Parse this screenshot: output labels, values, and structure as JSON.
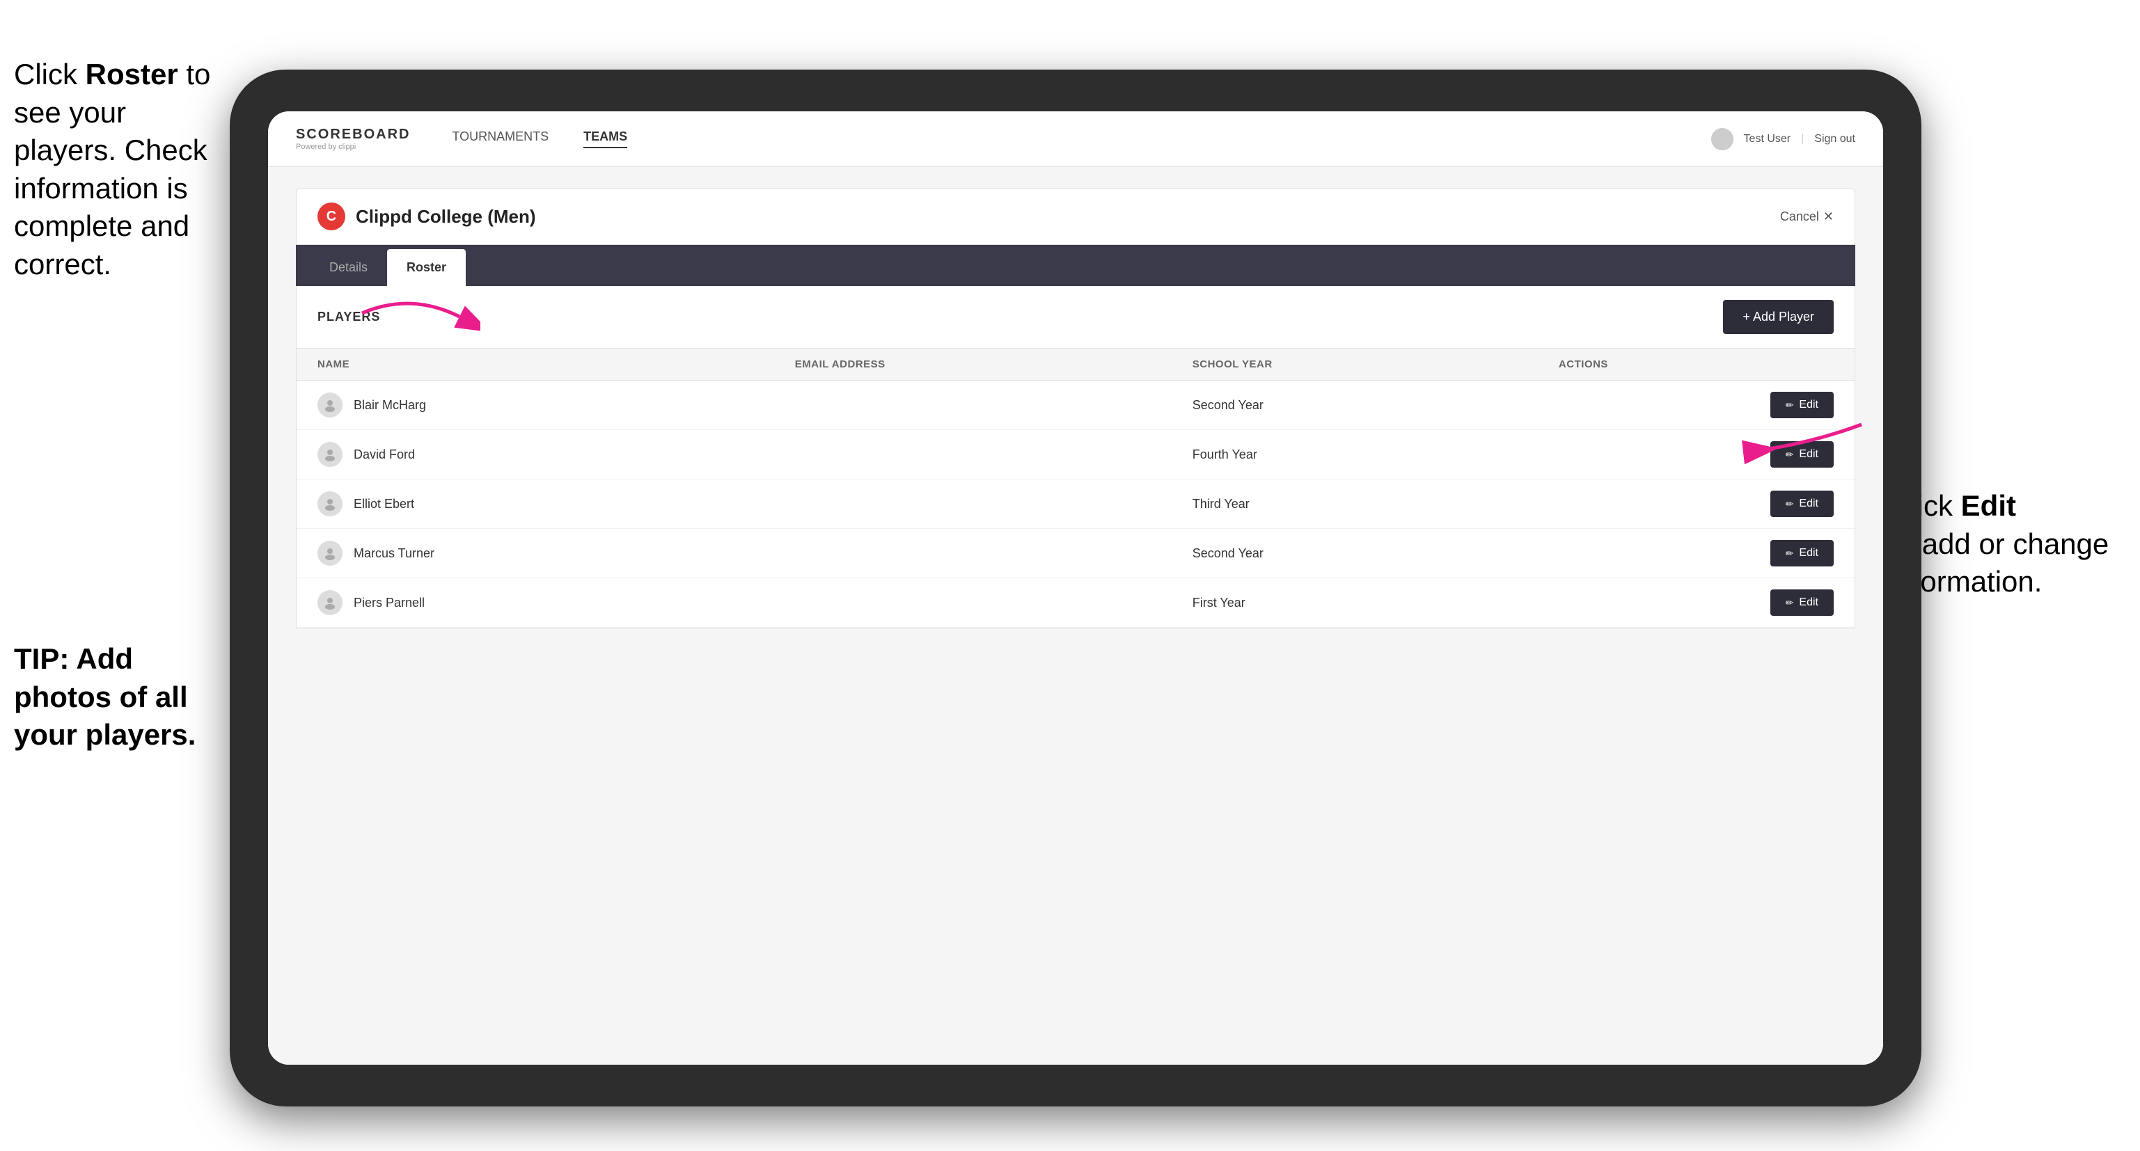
{
  "left_annotation": {
    "line1": "Click ",
    "bold1": "Roster",
    "line2": " to",
    "line3": "see your players.",
    "line4": "Check information",
    "line5": "is complete and",
    "line6": "correct."
  },
  "tip_annotation": {
    "text": "TIP: Add photos of all your players."
  },
  "right_annotation": {
    "line1": "Click ",
    "bold1": "Edit",
    "line2": "to add or change",
    "line3": "information."
  },
  "nav": {
    "logo": "SCOREBOARD",
    "logo_sub": "Powered by clippi",
    "links": [
      "TOURNAMENTS",
      "TEAMS"
    ],
    "active_link": "TEAMS",
    "user": "Test User",
    "separator": "|",
    "signout": "Sign out"
  },
  "team": {
    "logo_letter": "C",
    "name": "Clippd College (Men)",
    "cancel_label": "Cancel",
    "cancel_icon": "✕"
  },
  "tabs": [
    {
      "label": "Details",
      "active": false
    },
    {
      "label": "Roster",
      "active": true
    }
  ],
  "roster": {
    "section_label": "PLAYERS",
    "add_button_label": "+ Add Player",
    "columns": [
      "NAME",
      "EMAIL ADDRESS",
      "SCHOOL YEAR",
      "ACTIONS"
    ],
    "players": [
      {
        "name": "Blair McHarg",
        "email": "",
        "school_year": "Second Year"
      },
      {
        "name": "David Ford",
        "email": "",
        "school_year": "Fourth Year"
      },
      {
        "name": "Elliot Ebert",
        "email": "",
        "school_year": "Third Year"
      },
      {
        "name": "Marcus Turner",
        "email": "",
        "school_year": "Second Year"
      },
      {
        "name": "Piers Parnell",
        "email": "",
        "school_year": "First Year"
      }
    ],
    "edit_label": "Edit"
  }
}
